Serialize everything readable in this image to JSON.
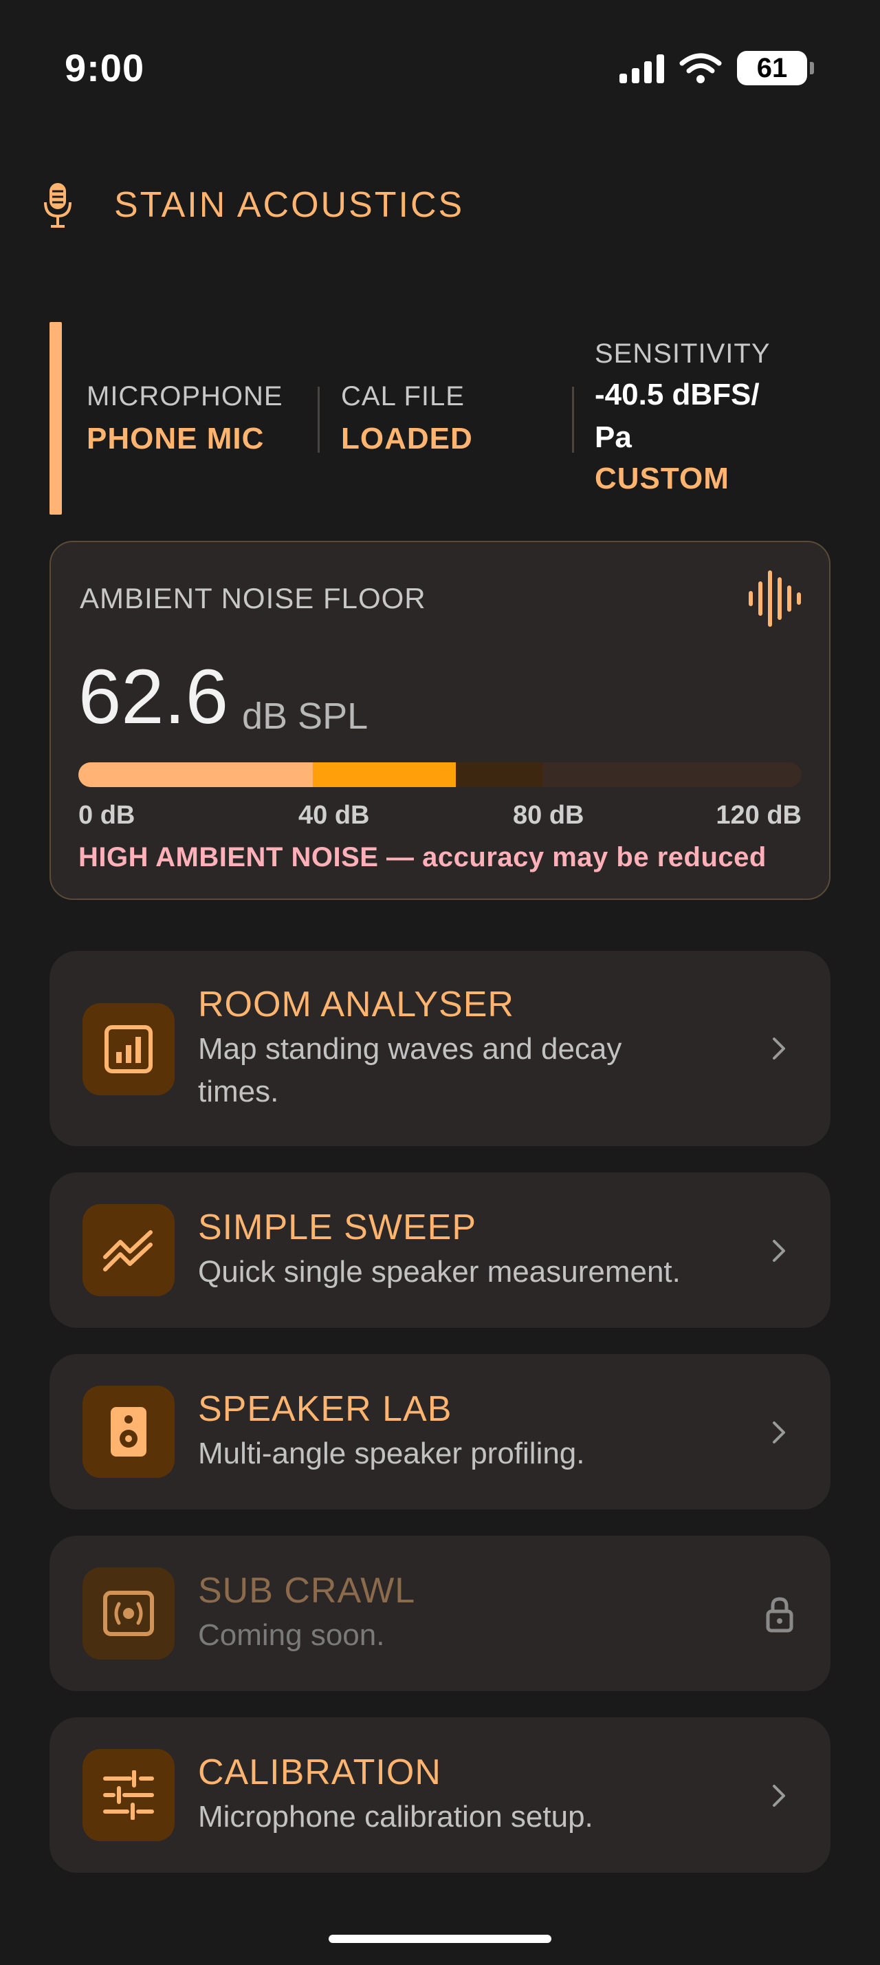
{
  "status_bar": {
    "time": "9:00",
    "battery": "61"
  },
  "header": {
    "title": "STAIN ACOUSTICS"
  },
  "info": {
    "microphone_label": "MICROPHONE",
    "microphone_value": "PHONE MIC",
    "cal_label": "CAL FILE",
    "cal_value": "LOADED",
    "sensitivity_label": "SENSITIVITY",
    "sensitivity_line1": "-40.5 dBFS/",
    "sensitivity_line2": "Pa",
    "sensitivity_mode": "CUSTOM"
  },
  "ambient": {
    "label": "AMBIENT NOISE FLOOR",
    "value": "62.6",
    "unit": "dB SPL",
    "meter_level_db": 62.6,
    "meter_max_db": 120,
    "ticks": [
      "0 dB",
      "40 dB",
      "80 dB",
      "120 dB"
    ],
    "warning": "HIGH AMBIENT NOISE — accuracy may be reduced"
  },
  "menu": [
    {
      "title": "ROOM ANALYSER",
      "subtitle": "Map standing waves and decay times.",
      "icon": "bar-chart-icon",
      "enabled": true
    },
    {
      "title": "SIMPLE SWEEP",
      "subtitle": "Quick single speaker measurement.",
      "icon": "sweep-lines-icon",
      "enabled": true
    },
    {
      "title": "SPEAKER LAB",
      "subtitle": "Multi-angle speaker profiling.",
      "icon": "speaker-icon",
      "enabled": true
    },
    {
      "title": "SUB CRAWL",
      "subtitle": "Coming soon.",
      "icon": "subwoofer-icon",
      "enabled": false
    },
    {
      "title": "CALIBRATION",
      "subtitle": "Microphone calibration setup.",
      "icon": "sliders-icon",
      "enabled": true
    }
  ],
  "colors": {
    "accent": "#ffb570",
    "meter_fill_1": "#ffb374",
    "meter_fill_2": "#ff9f0a",
    "meter_track_mid": "#3d2710",
    "warning": "#ffb0b8",
    "background": "#1a1a1a",
    "card": "#2a2726"
  }
}
